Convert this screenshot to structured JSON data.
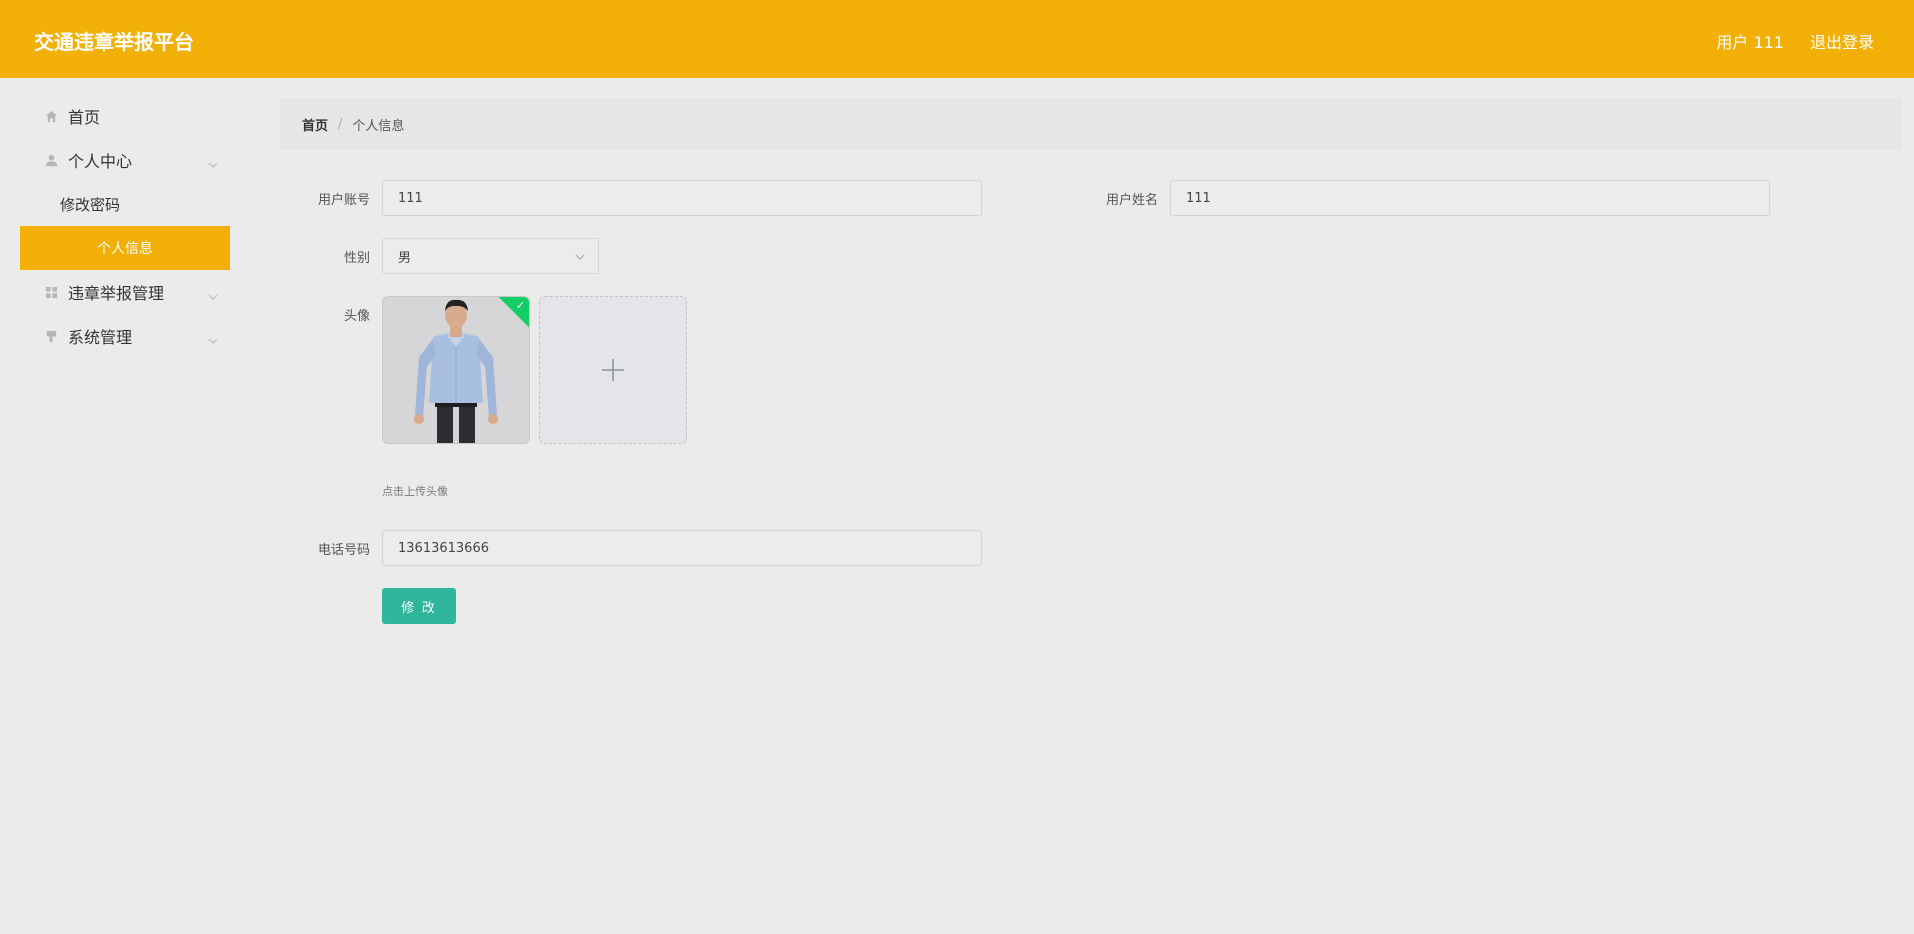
{
  "header": {
    "brand": "交通违章举报平台",
    "user_label": "用户 111",
    "logout_label": "退出登录"
  },
  "sidebar": {
    "items": [
      {
        "label": "首页",
        "icon": "home-icon"
      },
      {
        "label": "个人中心",
        "icon": "user-icon",
        "sub": [
          {
            "label": "修改密码"
          },
          {
            "label": "个人信息",
            "active": true
          }
        ]
      },
      {
        "label": "违章举报管理",
        "icon": "grid-icon"
      },
      {
        "label": "系统管理",
        "icon": "flag-icon"
      }
    ]
  },
  "breadcrumb": {
    "home": "首页",
    "separator": "/",
    "current": "个人信息"
  },
  "form": {
    "account_label": "用户账号",
    "account_value": "111",
    "name_label": "用户姓名",
    "name_value": "111",
    "gender_label": "性别",
    "gender_value": "男",
    "avatar_label": "头像",
    "upload_tip": "点击上传头像",
    "phone_label": "电话号码",
    "phone_value": "13613613666",
    "submit_label": "修 改"
  },
  "colors": {
    "primary": "#f2b007",
    "success": "#13ce66",
    "button": "#2fb59a",
    "background": "#ebebeb"
  }
}
